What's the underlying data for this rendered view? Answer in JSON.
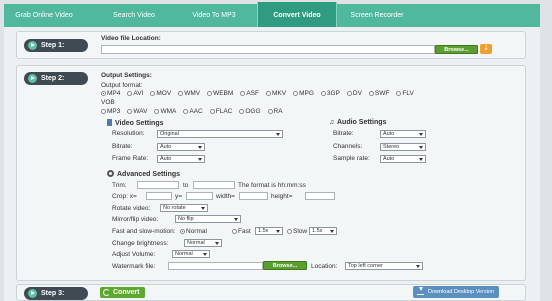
{
  "tabs": [
    {
      "label": "Grab Online Video"
    },
    {
      "label": "Search Video"
    },
    {
      "label": "Video To MP3"
    },
    {
      "label": "Convert Video"
    },
    {
      "label": "Screen Recorder"
    }
  ],
  "step1": {
    "label": "Step 1:",
    "file_location_label": "Video file Location:",
    "file_location_value": "",
    "browse": "Browse..."
  },
  "step2": {
    "label": "Step 2:",
    "output_settings": "Output Settings:",
    "output_format": "Output format:",
    "formats_row1": [
      "MP4",
      "AVI",
      "MOV",
      "WMV",
      "WEBM",
      "ASF",
      "MKV",
      "MPG",
      "3GP",
      "DV",
      "SWF",
      "FLV"
    ],
    "formats_row1b": [
      "VOB"
    ],
    "formats_row2": [
      "MP3",
      "WAV",
      "WMA",
      "AAC",
      "FLAC",
      "OGG",
      "RA"
    ],
    "selected_format": "MP4",
    "video_settings": "Video Settings",
    "audio_settings": "Audio Settings",
    "resolution_label": "Resolution:",
    "resolution_value": "Original",
    "vbitrate_label": "Bitrate:",
    "vbitrate_value": "Auto",
    "framerate_label": "Frame Rate:",
    "framerate_value": "Auto",
    "abitrate_label": "Bitrate:",
    "abitrate_value": "Auto",
    "channels_label": "Channels:",
    "channels_value": "Stereo",
    "samplerate_label": "Sample rate:",
    "samplerate_value": "Auto",
    "advanced_settings": "Advanced Settings",
    "trim_label": "Trim:",
    "trim_to": "to",
    "trim_format": "The format is hh:mm:ss",
    "crop_label": "Crop: x=",
    "crop_y": "y=",
    "crop_width": "width=",
    "crop_height": "height=",
    "rotate_label": "Rotate video:",
    "rotate_value": "No rotate",
    "mirror_label": "Mirror/flip video:",
    "mirror_value": "No flip",
    "motion_label": "Fast and slow-motion:",
    "motion_normal": "Normal",
    "motion_fast": "Fast",
    "motion_fast_value": "1.5x",
    "motion_slow": "Slow",
    "motion_slow_value": "1.5x",
    "brightness_label": "Change brightness:",
    "brightness_value": "Normal",
    "volume_label": "Adjust Volume:",
    "volume_value": "Normal",
    "watermark_label": "Watermark file:",
    "watermark_browse": "Browse...",
    "location_label": "Location:",
    "location_value": "Top left corner"
  },
  "step3": {
    "label": "Step 3:",
    "convert": "Convert",
    "download": "Download Desktop Version"
  },
  "colors": {
    "accent": "#50b89c",
    "active_tab": "#2f9c81",
    "browse": "#5a9e2f",
    "download": "#5b8fc2"
  }
}
